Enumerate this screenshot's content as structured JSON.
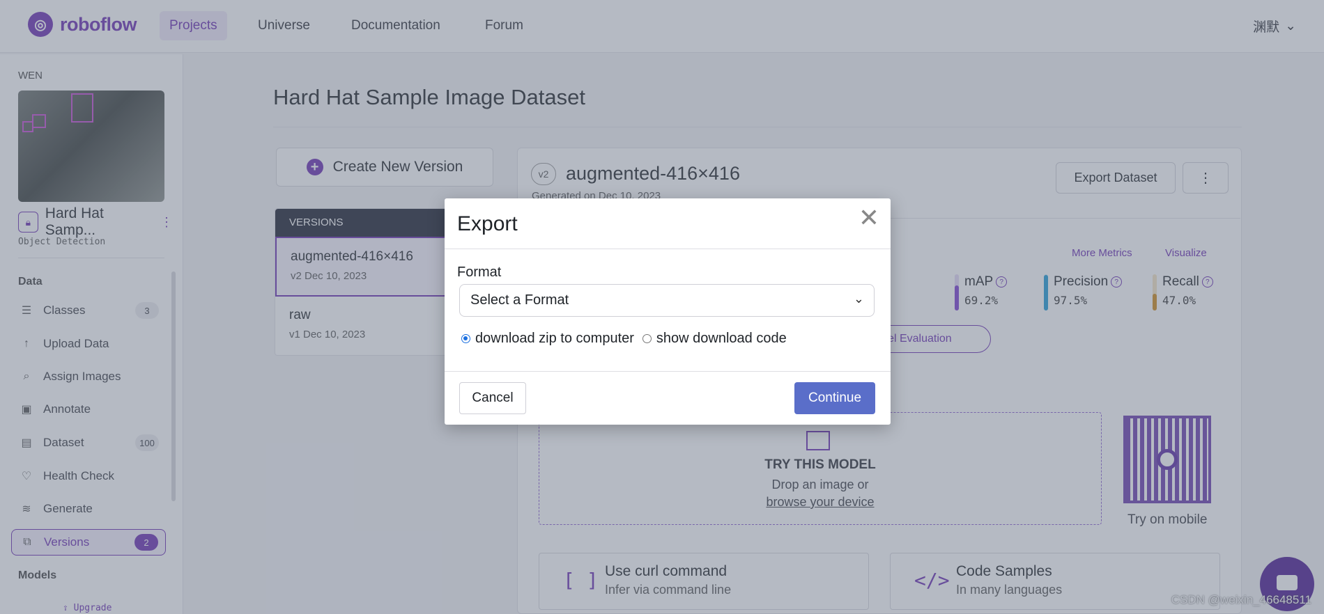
{
  "colors": {
    "brand": "#6b2fb3",
    "continue_button": "#5a6ec9",
    "overlay": "rgba(100,110,130,0.48)",
    "map_bar": "#7b3fd1",
    "precision_bar": "#1f9bd6",
    "recall_bar": "#d08a1a"
  },
  "nav": {
    "logo": "roboflow",
    "links": [
      "Projects",
      "Universe",
      "Documentation",
      "Forum"
    ],
    "user": "渊默",
    "user_icon": "chevron-down-icon"
  },
  "sidebar": {
    "workspace": "WEN",
    "project_name": "Hard Hat Samp...",
    "project_type": "Object Detection",
    "data_heading": "Data",
    "items": [
      {
        "label": "Classes",
        "icon": "list-icon",
        "count": "3"
      },
      {
        "label": "Upload Data",
        "icon": "upload-icon",
        "count": ""
      },
      {
        "label": "Assign Images",
        "icon": "search-icon",
        "count": ""
      },
      {
        "label": "Annotate",
        "icon": "annotate-icon",
        "count": ""
      },
      {
        "label": "Dataset",
        "icon": "image-stack-icon",
        "count": "100"
      },
      {
        "label": "Health Check",
        "icon": "heart-icon",
        "count": ""
      },
      {
        "label": "Generate",
        "icon": "layers-icon",
        "count": ""
      },
      {
        "label": "Versions",
        "icon": "versions-icon",
        "count": "2"
      }
    ],
    "models_heading": "Models",
    "upgrade": "Upgrade"
  },
  "main": {
    "page_title": "Hard Hat Sample Image Dataset",
    "create_version": "Create New Version",
    "versions_heading": "VERSIONS",
    "versions": [
      {
        "name": "augmented-416×416",
        "sub": "v2 Dec 10, 2023"
      },
      {
        "name": "raw",
        "sub": "v1 Dec 10, 2023"
      }
    ],
    "version_badge": "v2",
    "version_title": "augmented-416×416",
    "generated": "Generated on Dec 10, 2023",
    "export_dataset": "Export Dataset",
    "more_metrics": "More Metrics",
    "visualize": "Visualize",
    "metrics": [
      {
        "name": "mAP",
        "value": "69.2%",
        "fraction": 0.692
      },
      {
        "name": "Precision",
        "value": "97.5%",
        "fraction": 0.975
      },
      {
        "name": "Recall",
        "value": "47.0%",
        "fraction": 0.47
      }
    ],
    "model_eval": "odel Evaluation",
    "try_title": "TRY THIS MODEL",
    "try_sub": "Drop an image or",
    "try_link": "browse your device",
    "try_mobile": "Try on mobile",
    "tools": [
      {
        "icon": "[ ]",
        "title": "Use curl command",
        "sub": "Infer via command line"
      },
      {
        "icon": "</>",
        "title": "Code Samples",
        "sub": "In many languages"
      }
    ],
    "watermark": "CSDN @weixin_46648511"
  },
  "modal": {
    "title": "Export",
    "close": "✕",
    "format_label": "Format",
    "format_value": "Select a Format",
    "radio_zip": "download zip to computer",
    "radio_code": "show download code",
    "selected_radio": "zip",
    "cancel": "Cancel",
    "continue": "Continue"
  }
}
